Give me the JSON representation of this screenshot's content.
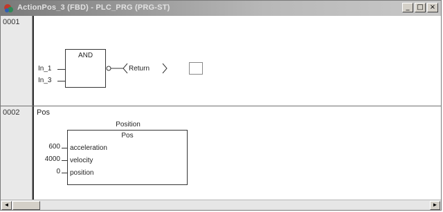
{
  "window": {
    "title": "ActionPos_3 (FBD) - PLC_PRG (PRG-ST)",
    "buttons": {
      "minimize": "_",
      "maximize": "□",
      "close": "×"
    }
  },
  "networks": [
    {
      "number": "0001",
      "label": "",
      "block": {
        "type": "AND",
        "inputs": [
          "In_1",
          "In_3"
        ]
      },
      "output": {
        "negated": true,
        "label": "Return"
      }
    },
    {
      "number": "0002",
      "label": "Pos",
      "instance": "Position",
      "block": {
        "type": "Pos",
        "inputs": [
          {
            "value": "600",
            "name": "acceleration"
          },
          {
            "value": "4000",
            "name": "velocity"
          },
          {
            "value": "0",
            "name": "position"
          }
        ]
      }
    }
  ],
  "scrollbar": {
    "left_arrow": "◄",
    "right_arrow": "►"
  },
  "colors": {
    "titlebar_start": "#7a7a7a",
    "titlebar_end": "#c8c8c8",
    "gutter": "#e9e9e9"
  }
}
